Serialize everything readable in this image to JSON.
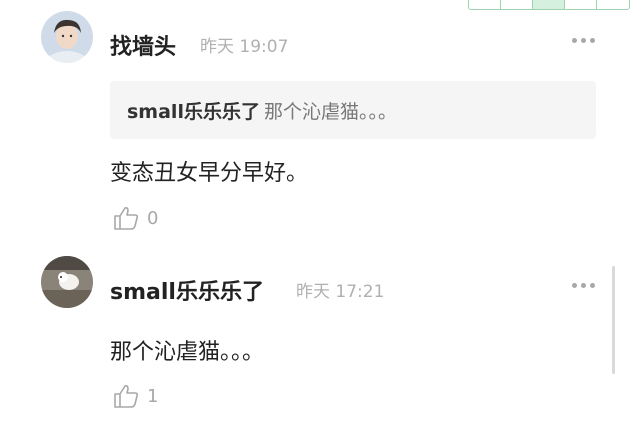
{
  "comments": [
    {
      "username": "找墙头",
      "time": "昨天 19:07",
      "quote": {
        "user": "small乐乐乐了",
        "text": "那个沁虐猫。。。"
      },
      "text": "变态丑女早分早好。",
      "likes": "0"
    },
    {
      "username": "small乐乐乐了",
      "time": "昨天 17:21",
      "text": "那个沁虐猫。。。",
      "likes": "1"
    }
  ],
  "icons": {
    "more": "more-dots-icon",
    "like": "thumbs-up-icon"
  },
  "colors": {
    "meta_gray": "#b0b0b0",
    "quote_bg": "#f5f5f5",
    "toolbar_green": "#3aa86a"
  }
}
